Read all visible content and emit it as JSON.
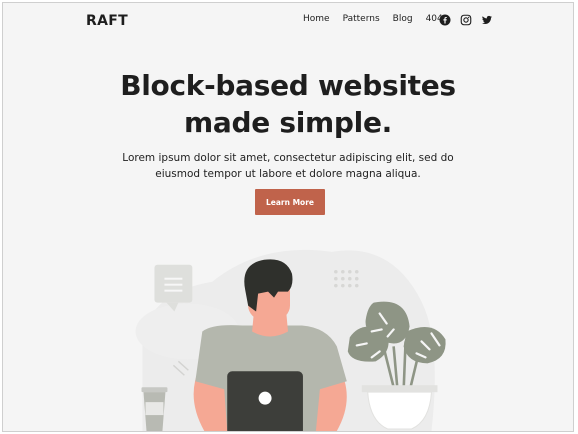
{
  "header": {
    "logo": "RAFT",
    "nav": [
      "Home",
      "Patterns",
      "Blog",
      "404"
    ],
    "social": [
      "facebook-icon",
      "instagram-icon",
      "twitter-icon"
    ]
  },
  "hero": {
    "title_line1": "Block-based websites",
    "title_line2": "made simple.",
    "subtitle_line1": "Lorem ipsum dolor sit amet, consectetur adipiscing elit, sed do",
    "subtitle_line2": "eiusmod tempor ut labore et dolore magna aliqua.",
    "cta_label": "Learn More"
  },
  "colors": {
    "background": "#f5f5f5",
    "accent": "#c0634b",
    "text": "#1e1e1e",
    "skin": "#f5a894",
    "shirt": "#b4b7ad",
    "hair": "#2f302c",
    "laptop": "#3d3e3a",
    "plant": "#8e9585"
  }
}
